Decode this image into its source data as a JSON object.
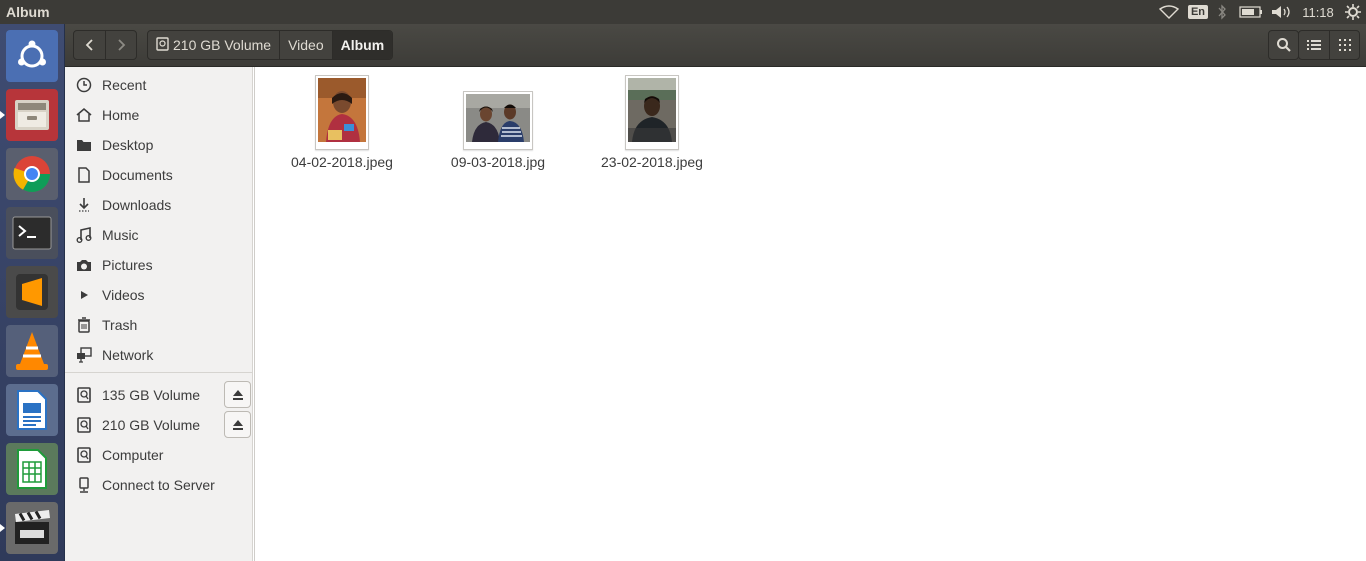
{
  "window": {
    "title": "Album"
  },
  "panel": {
    "indicators": [
      "wifi-icon",
      "keyboard-layout",
      "bluetooth-icon",
      "battery-icon",
      "volume-icon",
      "clock",
      "system-gear-icon"
    ],
    "keyboard_layout": "En",
    "clock": "11:18"
  },
  "launcher": {
    "items": [
      {
        "name": "ubuntu-dash-icon",
        "running": false
      },
      {
        "name": "files-app-icon",
        "running": true
      },
      {
        "name": "chrome-app-icon",
        "running": false
      },
      {
        "name": "terminal-app-icon",
        "running": false
      },
      {
        "name": "sublime-text-app-icon",
        "running": false
      },
      {
        "name": "vlc-app-icon",
        "running": false
      },
      {
        "name": "libreoffice-writer-app-icon",
        "running": false
      },
      {
        "name": "libreoffice-calc-app-icon",
        "running": false
      },
      {
        "name": "video-editor-app-icon",
        "running": true
      }
    ]
  },
  "breadcrumbs": [
    {
      "label": "210 GB Volume",
      "icon": "drive-icon"
    },
    {
      "label": "Video"
    },
    {
      "label": "Album",
      "active": true
    }
  ],
  "sidebar": {
    "places": [
      {
        "label": "Recent",
        "icon": "clock-icon"
      },
      {
        "label": "Home",
        "icon": "home-icon"
      },
      {
        "label": "Desktop",
        "icon": "folder-icon"
      },
      {
        "label": "Documents",
        "icon": "document-icon"
      },
      {
        "label": "Downloads",
        "icon": "download-icon"
      },
      {
        "label": "Music",
        "icon": "music-icon"
      },
      {
        "label": "Pictures",
        "icon": "camera-icon"
      },
      {
        "label": "Videos",
        "icon": "video-icon"
      },
      {
        "label": "Trash",
        "icon": "trash-icon"
      },
      {
        "label": "Network",
        "icon": "network-icon"
      }
    ],
    "devices": [
      {
        "label": "135 GB Volume",
        "icon": "drive-icon",
        "ejectable": true
      },
      {
        "label": "210 GB Volume",
        "icon": "drive-icon",
        "ejectable": true
      },
      {
        "label": "Computer",
        "icon": "drive-icon"
      },
      {
        "label": "Connect to Server",
        "icon": "server-icon"
      }
    ]
  },
  "files": [
    {
      "name": "04-02-2018.jpeg"
    },
    {
      "name": "09-03-2018.jpg"
    },
    {
      "name": "23-02-2018.jpeg"
    }
  ],
  "colors": {
    "panel": "#3c3b37",
    "launcher": "#3f4c72",
    "headerbar": "#45443f",
    "sidebar": "#f2f1f0",
    "content": "#ffffff",
    "text": "#3c3c3c"
  }
}
